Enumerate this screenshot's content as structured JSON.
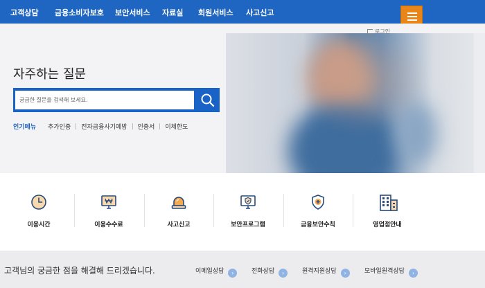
{
  "top_nav": {
    "items": [
      "고객상담",
      "금융소비자보호",
      "보안서비스",
      "자료실",
      "회원서비스",
      "사고신고"
    ]
  },
  "menu_button": {
    "icon": "hamburger-icon"
  },
  "login": {
    "label": "로그인",
    "icon": "login-icon"
  },
  "faq": {
    "title": "자주하는 질문",
    "search_placeholder": "궁금한 질문을 검색해 보세요.",
    "search_icon": "search-icon",
    "popular_label": "인기메뉴",
    "popular_keywords": [
      "추가인증",
      "전자금융사기예방",
      "인증서",
      "이체한도"
    ]
  },
  "quick_menu": [
    {
      "label": "이용시간",
      "icon": "clock-icon"
    },
    {
      "label": "이용수수료",
      "icon": "won-monitor-icon"
    },
    {
      "label": "사고신고",
      "icon": "siren-icon"
    },
    {
      "label": "보안프로그램",
      "icon": "shield-monitor-icon"
    },
    {
      "label": "금융보안수칙",
      "icon": "shield-plus-icon"
    },
    {
      "label": "영업점안내",
      "icon": "building-icon"
    }
  ],
  "bottom": {
    "message": "고객님의 궁금한 점을 해결해 드리겠습니다.",
    "links": [
      "이메일상담",
      "전화상담",
      "원격지원상담",
      "모바일원격상담"
    ],
    "arrow_icon": "arrow-right-icon"
  },
  "colors": {
    "nav_blue": "#1f66c3",
    "menu_orange": "#e8861a",
    "icon_orange": "#e89b3c",
    "icon_navy": "#274a7d"
  }
}
